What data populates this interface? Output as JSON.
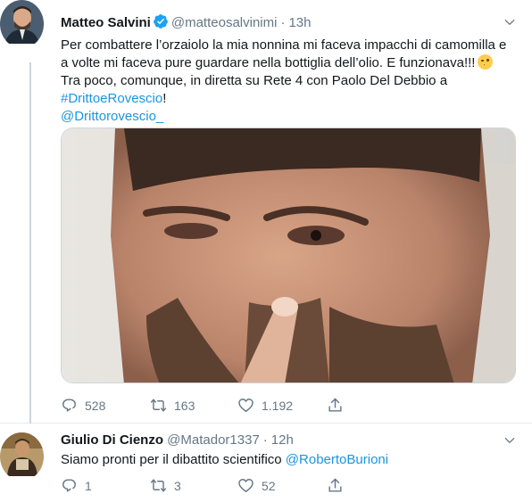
{
  "tweets": [
    {
      "name": "Matteo Salvini",
      "handle": "@matteosalvinimi",
      "separator": "·",
      "time": "13h",
      "text_line1": "Per combattere l’orzaiolo la mia nonnina mi faceva impacchi di camomilla e",
      "text_line2": "a volte mi faceva pure guardare nella bottiglia dell’olio. E funzionava!!!",
      "text_line3": "Tra poco, comunque, in diretta su Rete 4 con Paolo Del Debbio a",
      "hashtag": "#DrittoeRovescio",
      "hashtag_suffix": "!",
      "mention": "@Drittorovescio_",
      "replies": "528",
      "retweets": "163",
      "likes": "1.192"
    },
    {
      "name": "Giulio Di Cienzo",
      "handle": "@Matador1337",
      "separator": "·",
      "time": "12h",
      "text": "Siamo pronti per il dibattito scientifico",
      "mention": "@RobertoBurioni",
      "replies": "1",
      "retweets": "3",
      "likes": "52"
    }
  ],
  "colors": {
    "link": "#1b95e0",
    "muted": "#657786",
    "verified": "#1da1f2",
    "divider": "#e6ecf0"
  },
  "icons": [
    "verified-badge-icon",
    "chevron-down-icon",
    "reply-icon",
    "retweet-icon",
    "like-icon",
    "share-icon",
    "emoji-icon"
  ]
}
